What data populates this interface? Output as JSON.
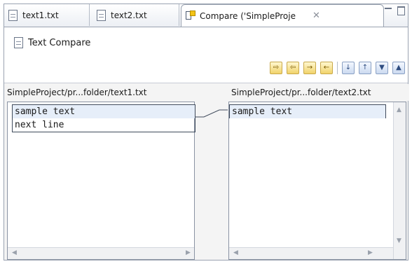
{
  "tabs": [
    {
      "label": "text1.txt",
      "icon": "text-file-icon"
    },
    {
      "label": "text2.txt",
      "icon": "text-file-icon"
    },
    {
      "label": "Compare ('SimpleProje",
      "icon": "compare-editor-icon",
      "close": "✕"
    }
  ],
  "window_controls": {
    "minimize": "minimize-icon",
    "maximize": "maximize-icon"
  },
  "header": {
    "title": "Text Compare",
    "icon": "text-file-icon"
  },
  "toolbar": {
    "buttons": [
      "copy-all-left-to-right-icon",
      "copy-all-right-to-left-icon",
      "copy-current-left-to-right-icon",
      "copy-current-right-to-left-icon",
      "next-difference-icon",
      "previous-difference-icon",
      "next-change-icon",
      "previous-change-icon"
    ]
  },
  "left": {
    "title": "SimpleProject/pr...folder/text1.txt",
    "lines": [
      "sample text",
      "next line"
    ]
  },
  "right": {
    "title": "SimpleProject/pr...folder/text2.txt",
    "lines": [
      "sample text"
    ]
  },
  "colors": {
    "highlight": "#e6eef9",
    "border": "#3f4a5b"
  }
}
